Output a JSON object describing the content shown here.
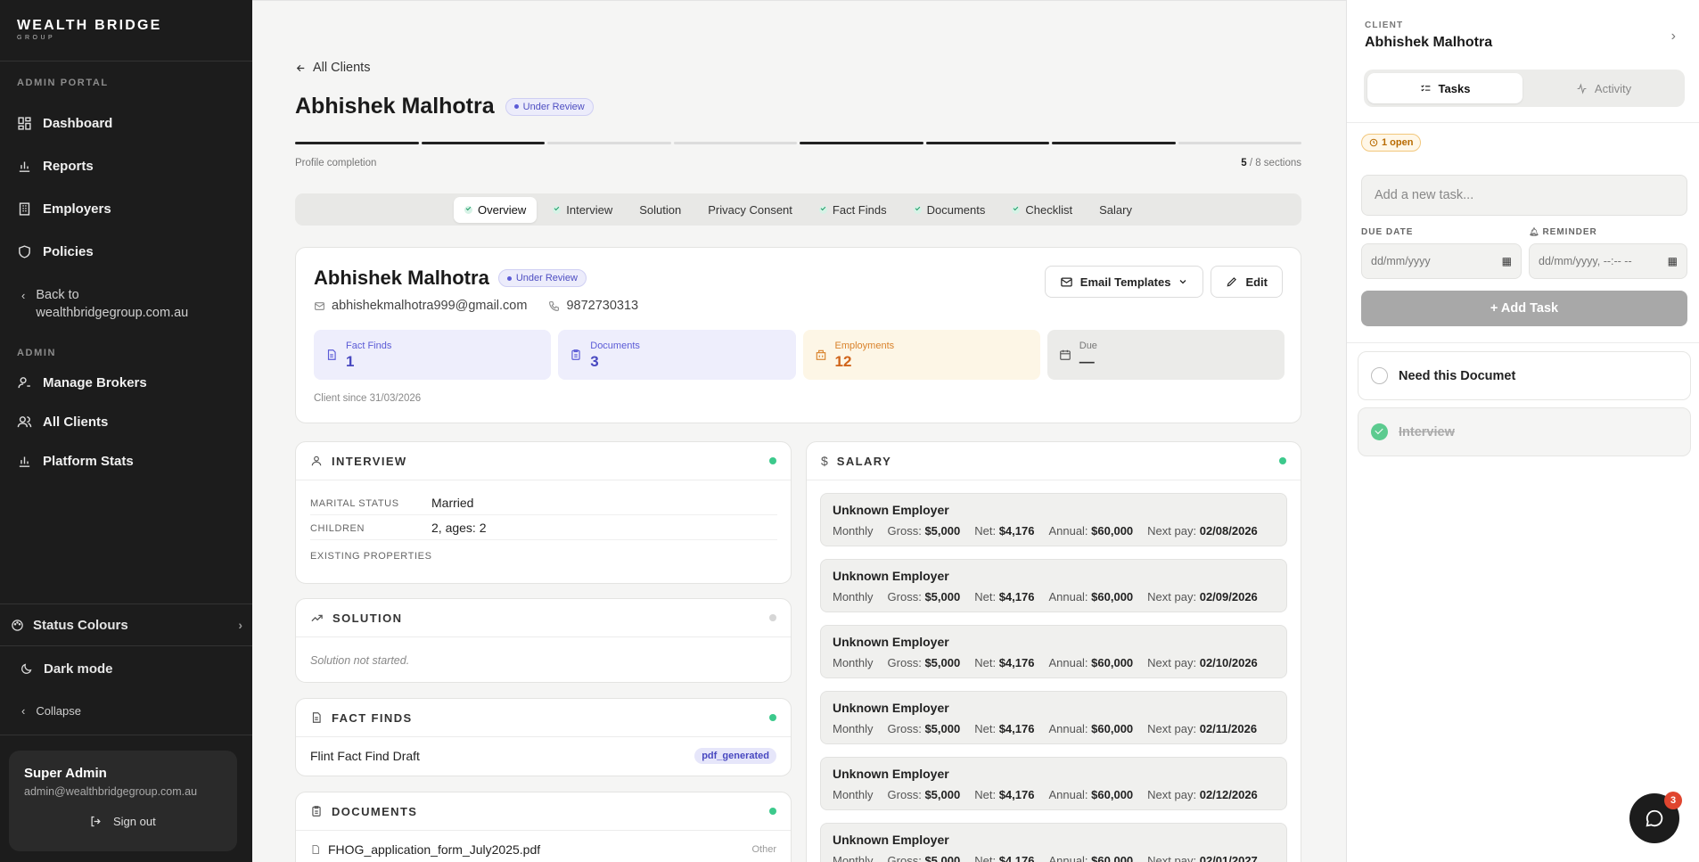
{
  "brand": {
    "name": "WEALTH BRIDGE",
    "sub": "GROUP"
  },
  "sidebar": {
    "section_admin_portal": "ADMIN PORTAL",
    "items": [
      {
        "label": "Dashboard",
        "icon": "dashboard-icon"
      },
      {
        "label": "Reports",
        "icon": "bar-chart-icon"
      },
      {
        "label": "Employers",
        "icon": "building-icon"
      },
      {
        "label": "Policies",
        "icon": "shield-icon"
      }
    ],
    "back_label": "Back to wealthbridgegroup.com.au",
    "section_admin": "ADMIN",
    "admin_items": [
      {
        "label": "Manage Brokers",
        "icon": "user-cog-icon"
      },
      {
        "label": "All Clients",
        "icon": "users-icon"
      },
      {
        "label": "Platform Stats",
        "icon": "bar-chart-icon"
      }
    ],
    "status_colours": "Status Colours",
    "dark_mode": "Dark mode",
    "collapse": "Collapse",
    "user": {
      "name": "Super Admin",
      "email": "admin@wealthbridgegroup.com.au",
      "sign_out": "Sign out"
    }
  },
  "main": {
    "back_link": "All Clients",
    "title": "Abhishek Malhotra",
    "status": "Under Review",
    "progress": {
      "label": "Profile completion",
      "done": "5",
      "total_text": "/ 8 sections",
      "segments": [
        1,
        1,
        0,
        0,
        1,
        1,
        1,
        0
      ]
    },
    "tabs": [
      {
        "label": "Overview",
        "checked": true,
        "active": true
      },
      {
        "label": "Interview",
        "checked": true,
        "active": false
      },
      {
        "label": "Solution",
        "checked": false,
        "active": false
      },
      {
        "label": "Privacy Consent",
        "checked": false,
        "active": false
      },
      {
        "label": "Fact Finds",
        "checked": true,
        "active": false
      },
      {
        "label": "Documents",
        "checked": true,
        "active": false
      },
      {
        "label": "Checklist",
        "checked": true,
        "active": false
      },
      {
        "label": "Salary",
        "checked": false,
        "active": false
      }
    ],
    "profile": {
      "name": "Abhishek Malhotra",
      "status": "Under Review",
      "email": "abhishekmalhotra999@gmail.com",
      "phone": "9872730313",
      "email_templates": "Email Templates",
      "edit": "Edit",
      "stats": [
        {
          "label": "Fact Finds",
          "value": "1"
        },
        {
          "label": "Documents",
          "value": "3"
        },
        {
          "label": "Employments",
          "value": "12"
        },
        {
          "label": "Due",
          "value": "—"
        }
      ],
      "client_since": "Client since 31/03/2026"
    },
    "interview": {
      "title": "INTERVIEW",
      "fields": [
        {
          "key": "MARITAL STATUS",
          "value": "Married"
        },
        {
          "key": "CHILDREN",
          "value": "2, ages: 2"
        },
        {
          "key": "EXISTING PROPERTIES",
          "value": ""
        }
      ]
    },
    "solution": {
      "title": "SOLUTION",
      "empty": "Solution not started."
    },
    "fact_finds": {
      "title": "FACT FINDS",
      "item": "Flint Fact Find Draft",
      "badge": "pdf_generated"
    },
    "documents": {
      "title": "DOCUMENTS",
      "item": "FHOG_application_form_July2025.pdf",
      "tag": "Other"
    },
    "salary": {
      "title": "SALARY",
      "labels": {
        "freq": "Monthly",
        "gross": "Gross:",
        "net": "Net:",
        "annual": "Annual:",
        "next": "Next pay:"
      },
      "items": [
        {
          "employer": "Unknown Employer",
          "gross": "$5,000",
          "net": "$4,176",
          "annual": "$60,000",
          "next_pay": "02/08/2026"
        },
        {
          "employer": "Unknown Employer",
          "gross": "$5,000",
          "net": "$4,176",
          "annual": "$60,000",
          "next_pay": "02/09/2026"
        },
        {
          "employer": "Unknown Employer",
          "gross": "$5,000",
          "net": "$4,176",
          "annual": "$60,000",
          "next_pay": "02/10/2026"
        },
        {
          "employer": "Unknown Employer",
          "gross": "$5,000",
          "net": "$4,176",
          "annual": "$60,000",
          "next_pay": "02/11/2026"
        },
        {
          "employer": "Unknown Employer",
          "gross": "$5,000",
          "net": "$4,176",
          "annual": "$60,000",
          "next_pay": "02/12/2026"
        },
        {
          "employer": "Unknown Employer",
          "gross": "$5,000",
          "net": "$4,176",
          "annual": "$60,000",
          "next_pay": "02/01/2027"
        }
      ]
    }
  },
  "panel": {
    "label": "CLIENT",
    "name": "Abhishek Malhotra",
    "tab_tasks": "Tasks",
    "tab_activity": "Activity",
    "open_badge": "1 open",
    "task_placeholder": "Add a new task...",
    "due_label": "DUE DATE",
    "reminder_label": "REMINDER",
    "due_placeholder": "dd/mm/yyyy",
    "reminder_placeholder": "dd/mm/yyyy, --:-- --",
    "add_task": "+ Add Task",
    "tasks": [
      {
        "title": "Need this Documet",
        "done": false
      },
      {
        "title": "Interview",
        "done": true
      }
    ],
    "chat_count": "3"
  },
  "colors": {
    "accent": "#5b5bd6",
    "success": "#3cc98c",
    "warning": "#d9822b",
    "sidebar_bg": "#1c1c1c"
  }
}
